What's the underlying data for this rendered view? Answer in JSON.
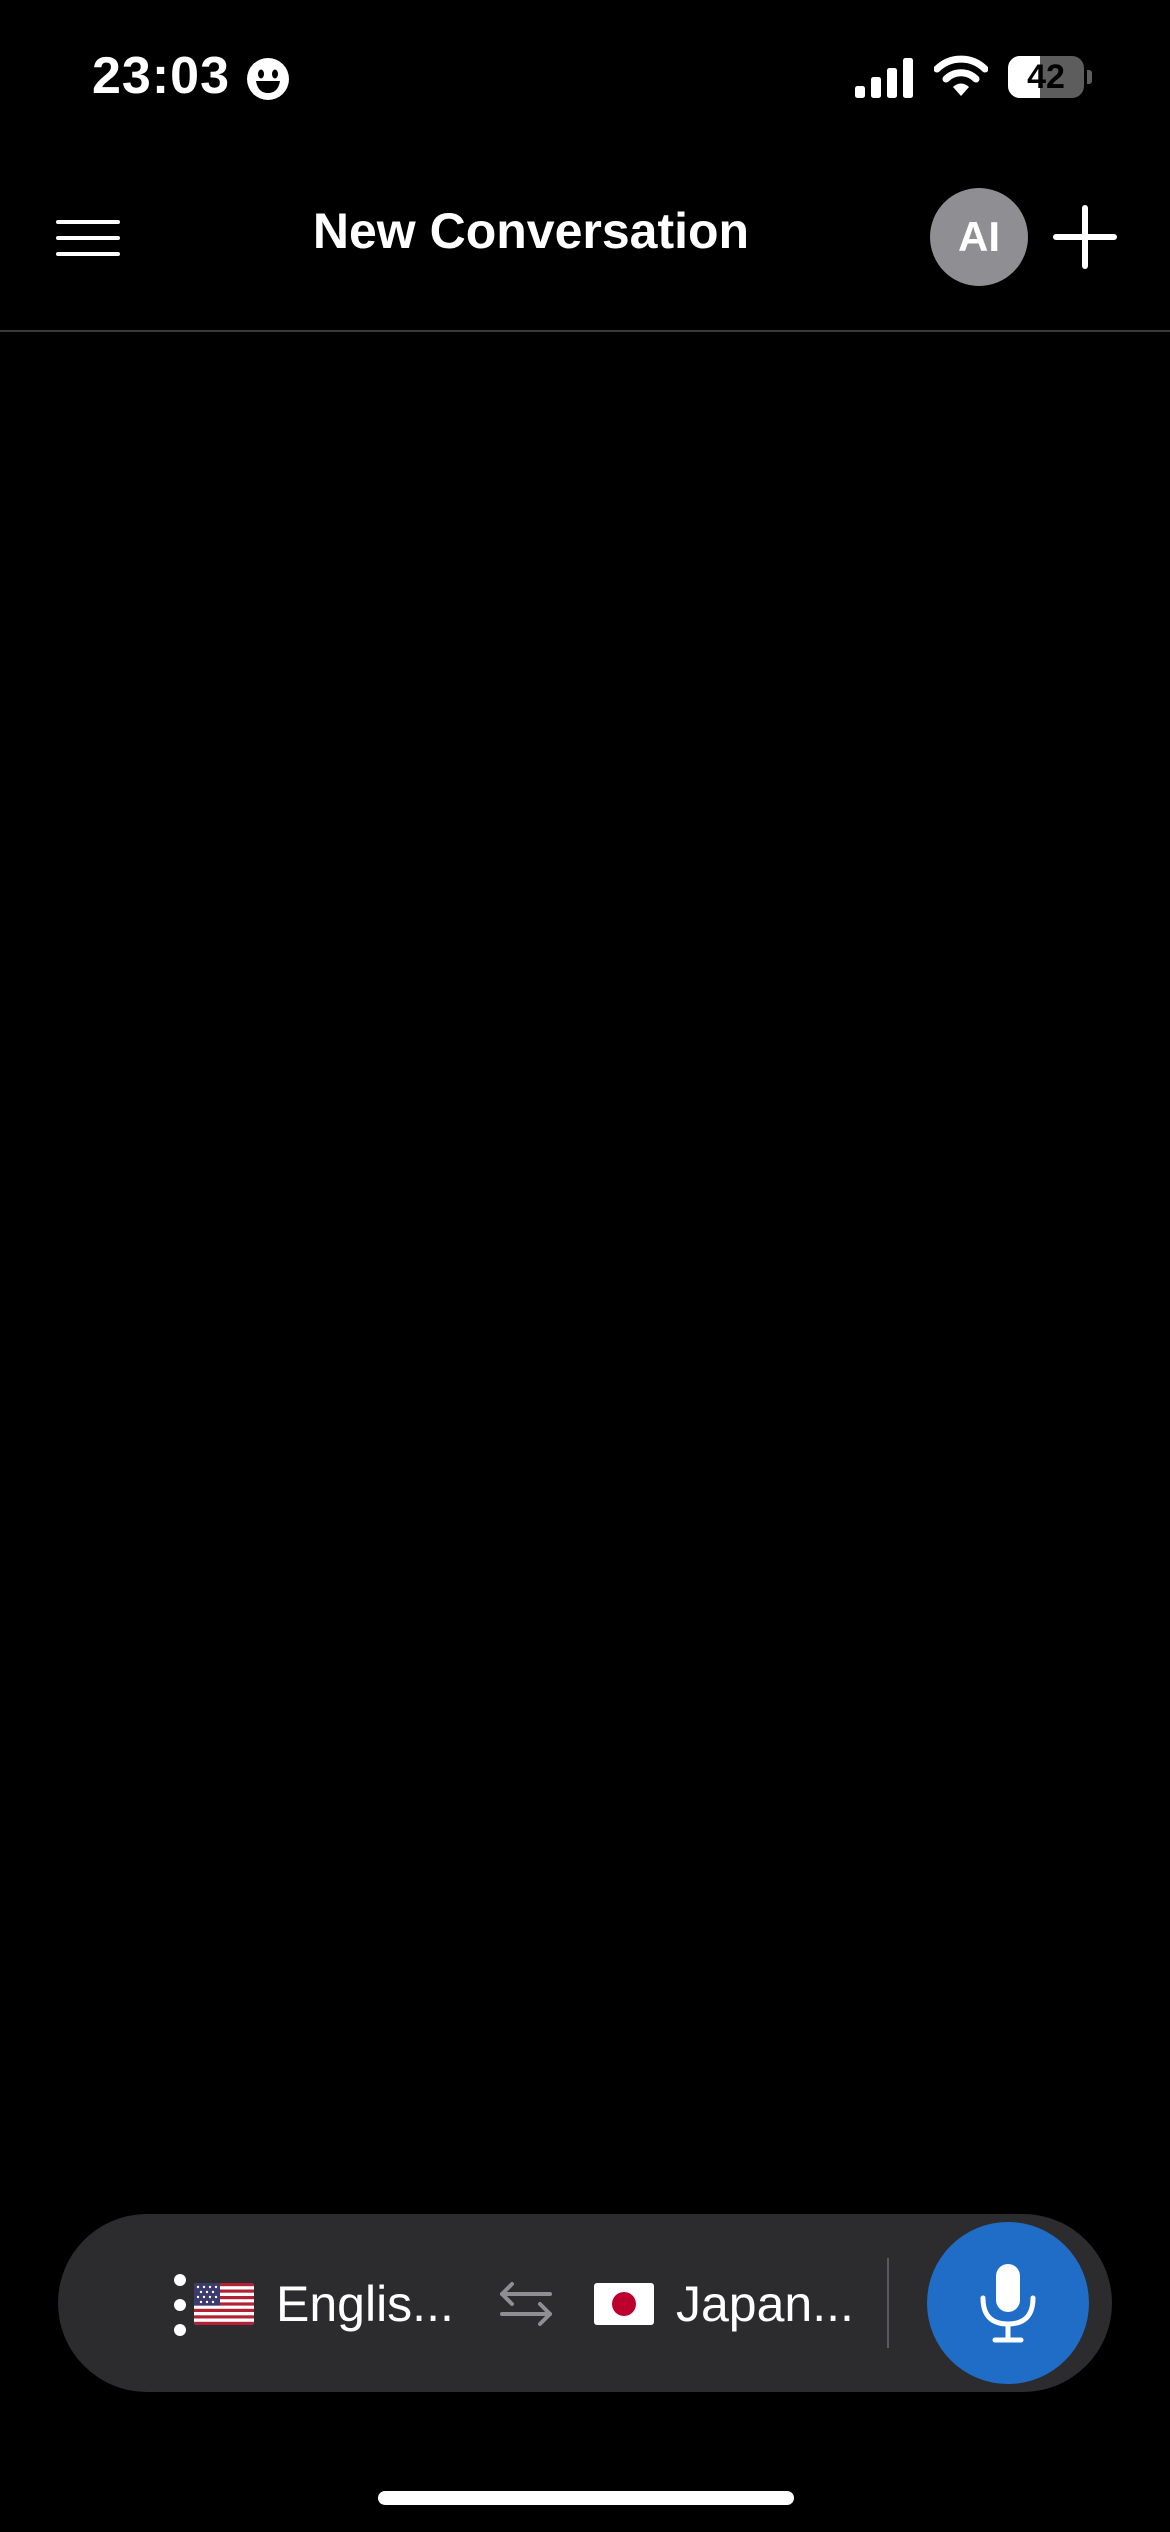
{
  "status_bar": {
    "time": "23:03",
    "battery_level": 42,
    "battery_text": "42"
  },
  "header": {
    "title": "New Conversation",
    "avatar_label": "AI",
    "menu_icon": "hamburger-menu-icon",
    "new_icon": "plus-icon"
  },
  "toolbar": {
    "source_language": "Englis...",
    "source_flag": "us-flag-icon",
    "target_language": "Japan...",
    "target_flag": "japan-flag-icon",
    "swap_icon": "swap-arrows-icon",
    "more_icon": "vertical-ellipsis-icon",
    "mic_icon": "microphone-icon"
  },
  "colors": {
    "background": "#000000",
    "toolbar_background": "#2c2c2e",
    "mic_button": "#1f6dc6",
    "avatar_background": "#8e8e93",
    "divider": "#3a3a3c"
  }
}
